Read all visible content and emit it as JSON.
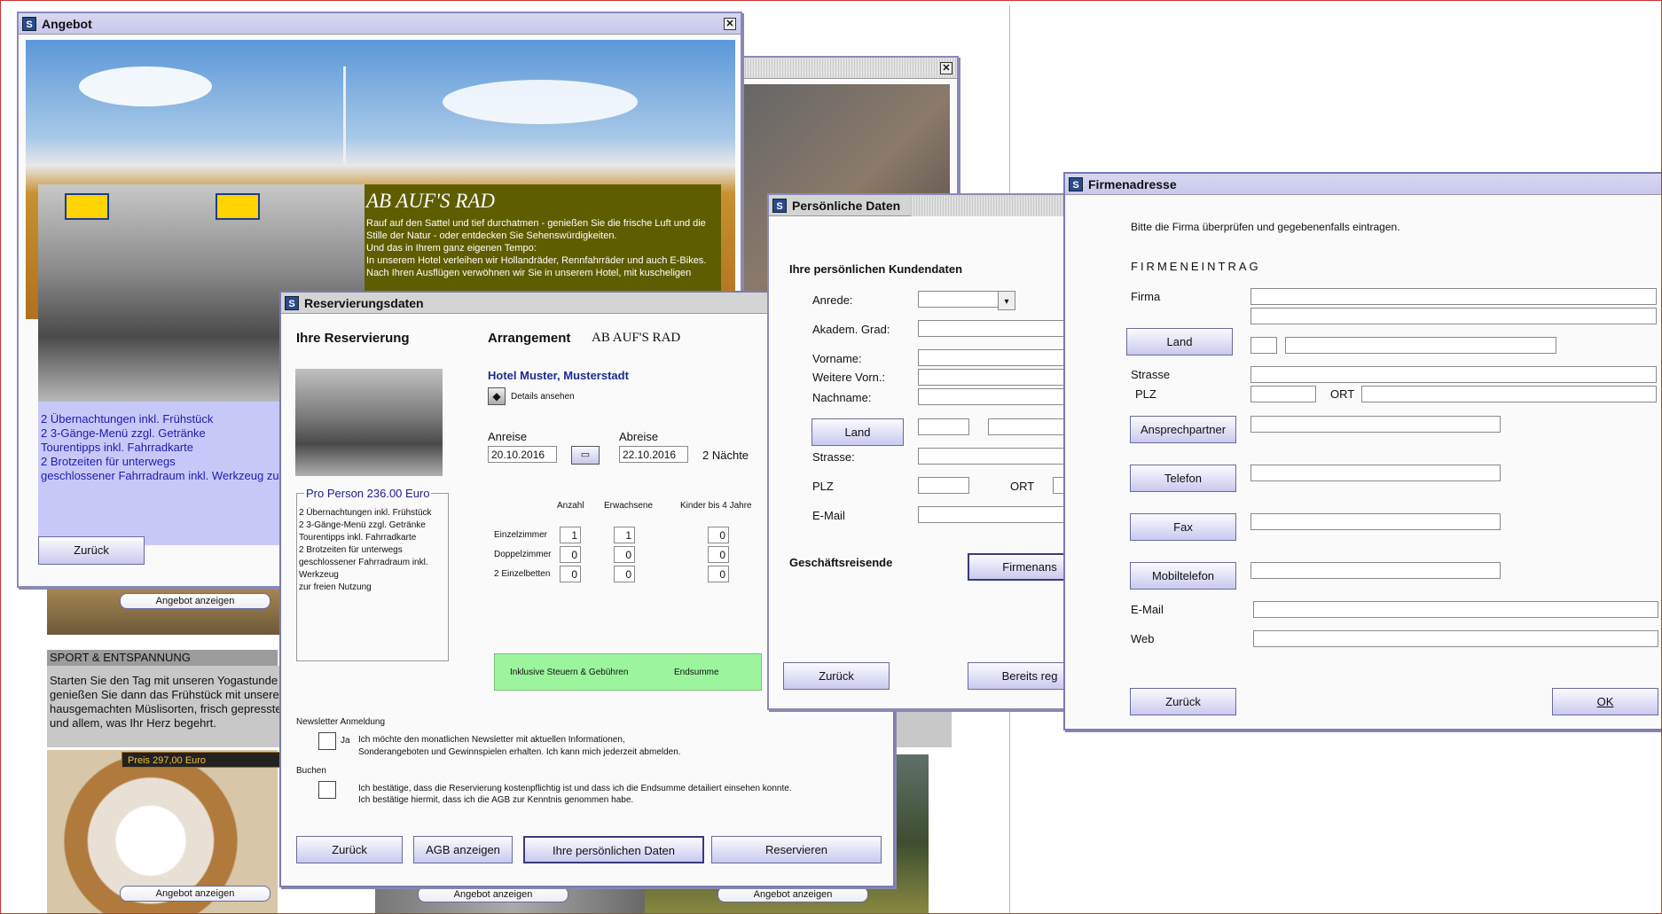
{
  "angebot": {
    "title": "Angebot",
    "heading": "AB AUF'S RAD",
    "description": [
      "Rauf auf den Sattel und tief durchatmen - genießen Sie die frische Luft und die",
      "Stille der Natur - oder entdecken Sie Sehenswürdigkeiten.",
      "Und das in Ihrem ganz eigenen Tempo:",
      "In unserem Hotel verleihen wir Hollandräder, Rennfahrräder und auch E-Bikes.",
      "Nach Ihren Ausflügen verwöhnen wir Sie in unserem Hotel, mit kuscheligen"
    ],
    "items": [
      "2 Übernachtungen inkl. Frühstück",
      "2 3-Gänge-Menü zzgl. Getränke",
      "Tourentipps inkl. Fahrradkarte",
      "2 Brotzeiten für unterwegs",
      "geschlossener Fahrradraum inkl. Werkzeug zur"
    ],
    "back": "Zurück"
  },
  "background": {
    "show_offer": "Angebot anzeigen",
    "sport_title": "SPORT & ENTSPANNUNG",
    "sport_text": [
      "Starten Sie den Tag mit unseren Yogastunde",
      "genießen Sie dann das Frühstück mit unsere",
      "hausgemachten Müslisorten, frisch gepresste",
      "und allem, was Ihr Herz begehrt."
    ],
    "price": "Preis 297,00 Euro"
  },
  "reservierung": {
    "title": "Reservierungsdaten",
    "heading": "Ihre Reservierung",
    "arr_label": "Arrangement",
    "arr_value": "AB AUF'S RAD",
    "hotel": "Hotel Muster, Musterstadt",
    "details": "Details ansehen",
    "anreise_label": "Anreise",
    "anreise": "20.10.2016",
    "abreise_label": "Abreise",
    "abreise": "22.10.2016",
    "naechte": "2 Nächte",
    "pro_person": "Pro Person 236.00 Euro",
    "items": [
      "2 Übernachtungen inkl. Frühstück",
      "2 3-Gänge-Menü zzgl. Getränke",
      "Tourentipps inkl. Fahrradkarte",
      "2 Brotzeiten für unterwegs",
      "geschlossener Fahrradraum inkl. Werkzeug",
      "zur freien Nutzung"
    ],
    "col_anzahl": "Anzahl",
    "col_erw": "Erwachsene",
    "col_kinder": "Kinder bis 4 Jahre",
    "rows": [
      {
        "label": "Einzelzimmer",
        "anzahl": "1",
        "erw": "1",
        "kinder": "0"
      },
      {
        "label": "Doppelzimmer",
        "anzahl": "0",
        "erw": "0",
        "kinder": "0"
      },
      {
        "label": "2 Einzelbetten",
        "anzahl": "0",
        "erw": "0",
        "kinder": "0"
      }
    ],
    "steuern": "Inklusive Steuern & Gebühren",
    "endsumme": "Endsumme",
    "newsletter_head": "Newsletter Anmeldung",
    "ja": "Ja",
    "newsletter_text1": "Ich möchte den monatlichen Newsletter mit aktuellen Informationen,",
    "newsletter_text2": "Sonderangeboten und Gewinnspielen erhalten. Ich kann mich jederzeit abmelden.",
    "buchen_head": "Buchen",
    "buchen_text1": "Ich bestätige, dass die Reservierung kostenpflichtig ist und dass ich die Endsumme detailiert einsehen konnte.",
    "buchen_text2": "Ich bestätige hiermit, dass ich die AGB zur Kenntnis genommen habe.",
    "btn_back": "Zurück",
    "btn_agb": "AGB anzeigen",
    "btn_personal": "Ihre persönlichen Daten",
    "btn_reserve": "Reservieren"
  },
  "persoenlich": {
    "title": "Persönliche Daten",
    "heading": "Ihre persönlichen Kundendaten",
    "anrede": "Anrede:",
    "grad": "Akadem. Grad:",
    "vorname": "Vorname:",
    "weitere": "Weitere Vorn.:",
    "nachname": "Nachname:",
    "land": "Land",
    "strasse": "Strasse:",
    "plz": "PLZ",
    "ort": "ORT",
    "email": "E-Mail",
    "geschaeft": "Geschäftsreisende",
    "firmen_btn": "Firmenans",
    "back": "Zurück",
    "bereits": "Bereits reg"
  },
  "firma": {
    "title": "Firmenadresse",
    "intro": "Bitte die Firma überprüfen und gegebenenfalls eintragen.",
    "section": "FIRMENEINTRAG",
    "firma": "Firma",
    "land": "Land",
    "strasse": "Strasse",
    "plz": "PLZ",
    "ort": "ORT",
    "ansprechpartner": "Ansprechpartner",
    "telefon": "Telefon",
    "fax": "Fax",
    "mobil": "Mobiltelefon",
    "email": "E-Mail",
    "web": "Web",
    "back": "Zurück",
    "ok": "OK"
  },
  "colors": {
    "accent": "#c8c8ee",
    "olive": "#5e5e00",
    "green": "#9cf59c",
    "lavender": "#c8c8f8"
  }
}
